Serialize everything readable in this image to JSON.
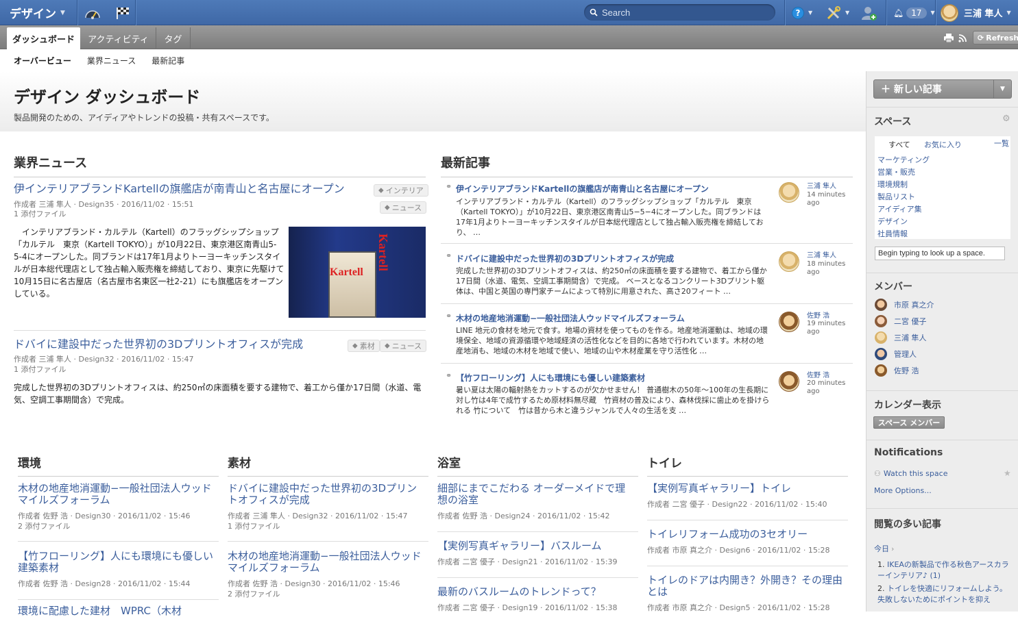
{
  "topbar": {
    "app_title": "デザイン",
    "search_placeholder": "Search",
    "notif_count": "17",
    "user_name": "三浦 隼人"
  },
  "tabs": [
    "ダッシュボード",
    "アクティビティ",
    "タグ"
  ],
  "refresh_label": "Refresh",
  "subnav": [
    "オーバービュー",
    "業界ニュース",
    "最新記事"
  ],
  "header": {
    "title": "デザイン ダッシュボード",
    "desc": "製品開発のための、アイディアやトレンドの投稿・共有スペースです。"
  },
  "industry_news": {
    "heading": "業界ニュース",
    "items": [
      {
        "title": "伊インテリアブランドKartellの旗艦店が南青山と名古屋にオープン",
        "meta": "作成者 三浦 隼人 · Design35 · 2016/11/02 · 15:51",
        "attach": "1 添付ファイル",
        "tags": [
          "インテリア",
          "ニュース"
        ],
        "body": [
          "　インテリアブランド・カルテル（Kartell）のフラッグシップショップ",
          "「カルテル　東京（Kartell TOKYO）」が10月22日、東京港区南青山5-",
          "5-4にオープンした。同ブランドは17年1月よりトーヨーキッチンスタイ",
          "ルが日本総代理店として独占輸入販売権を締結しており、東京に先駆けて",
          "10月15日に名古屋店（名古屋市名東区一社2-21）にも旗艦店をオープン",
          "している。"
        ],
        "image_text": "Kartell"
      },
      {
        "title": "ドバイに建設中だった世界初の3Dプリントオフィスが完成",
        "meta": "作成者 三浦 隼人 · Design32 · 2016/11/02 · 15:47",
        "attach": "1 添付ファイル",
        "tags": [
          "素材",
          "ニュース"
        ],
        "body": [
          "完成した世界初の3Dプリントオフィスは、約250㎡の床面積を要する建物で、着工から僅か17日間（水道、電",
          "気、空調工事期間含）で完成。"
        ]
      }
    ]
  },
  "recent": {
    "heading": "最新記事",
    "items": [
      {
        "title": "伊インテリアブランドKartellの旗艦店が南青山と名古屋にオープン",
        "body": [
          "インテリアブランド・カルテル（Kartell）のフラッグシップショップ「カルテル　東京",
          "（Kartell TOKYO）」が10月22日、東京港区南青山5−5−4にオープンした。同ブランドは",
          "17年1月よりトーヨーキッチンスタイルが日本総代理店として独占輸入販売権を締結してお",
          "り、 …"
        ],
        "user": "三浦 隼人",
        "time": "14 minutes ago"
      },
      {
        "title": "ドバイに建設中だった世界初の3Dプリントオフィスが完成",
        "body": [
          "完成した世界初の3Dプリントオフィスは、約250㎡の床面積を要する建物で、着工から僅か",
          "17日間（水道、電気、空調工事期間含）で完成。 ベースとなるコンクリート3Dプリント躯",
          "体は、中国と英国の専門家チームによって特別に用意された、高さ20フィート …"
        ],
        "user": "三浦 隼人",
        "time": "18 minutes ago"
      },
      {
        "title": "木材の地産地消運動−一般社団法人ウッドマイルズフォーラム",
        "body": [
          "LINE 地元の食材を地元で食す。地場の資材を使ってものを作る。地産地消運動は、地域の環",
          "境保全、地域の資源循環や地域経済の活性化などを目的に各地で行われています。木材の地",
          "産地消も、地域の木材を地域で使い、地域の山や木材産業を守り活性化 …"
        ],
        "user": "佐野 浩",
        "time": "19 minutes ago"
      },
      {
        "title": "【竹フローリング】人にも環境にも優しい建築素材",
        "body": [
          "暑い夏は太陽の輻射熱をカットするのが欠かせません！ 普通樹木の50年〜100年の生長期に",
          "対し竹は4年で成竹するため原材料無尽蔵　竹資材の普及により、森林伐採に歯止めを掛けら",
          "れる 竹について　竹は昔から木と違うジャンルで人々の生活を支 …"
        ],
        "user": "佐野 浩",
        "time": "20 minutes ago"
      }
    ]
  },
  "columns": [
    {
      "heading": "環境",
      "items": [
        {
          "title": [
            "木材の地産地消運動−一般社団法人ウッド",
            "マイルズフォーラム"
          ],
          "meta": "作成者 佐野 浩 · Design30 · 2016/11/02 · 15:46",
          "attach": "2 添付ファイル"
        },
        {
          "title": [
            "【竹フローリング】人にも環境にも優しい",
            "建築素材"
          ],
          "meta": "作成者 佐野 浩 · Design28 · 2016/11/02 · 15:44",
          "attach": ""
        },
        {
          "title": [
            "環境に配慮した建材　WPRC（木材"
          ],
          "meta": "",
          "attach": ""
        }
      ]
    },
    {
      "heading": "素材",
      "items": [
        {
          "title": [
            "ドバイに建設中だった世界初の3Dプリン",
            "トオフィスが完成"
          ],
          "meta": "作成者 三浦 隼人 · Design32 · 2016/11/02 · 15:47",
          "attach": "1 添付ファイル"
        },
        {
          "title": [
            "木材の地産地消運動−一般社団法人ウッド",
            "マイルズフォーラム"
          ],
          "meta": "作成者 佐野 浩 · Design30 · 2016/11/02 · 15:46",
          "attach": "2 添付ファイル"
        }
      ]
    },
    {
      "heading": "浴室",
      "items": [
        {
          "title": [
            "細部にまでこだわる オーダーメイドで理",
            "想の浴室"
          ],
          "meta": "作成者 佐野 浩 · Design24 · 2016/11/02 · 15:42",
          "attach": ""
        },
        {
          "title": [
            "【実例写真ギャラリー】バスルーム"
          ],
          "meta": "作成者 二宮 優子 · Design21 · 2016/11/02 · 15:39",
          "attach": ""
        },
        {
          "title": [
            "最新のバスルームのトレンドって？"
          ],
          "meta": "作成者 二宮 優子 · Design19 · 2016/11/02 · 15:38",
          "attach": ""
        }
      ]
    },
    {
      "heading": "トイレ",
      "items": [
        {
          "title": [
            "【実例写真ギャラリー】トイレ"
          ],
          "meta": "作成者 二宮 優子 · Design22 · 2016/11/02 · 15:40",
          "attach": ""
        },
        {
          "title": [
            "トイレリフォーム成功の3セオリー"
          ],
          "meta": "作成者 市原 真之介 · Design6 · 2016/11/02 · 15:28",
          "attach": ""
        },
        {
          "title": [
            "トイレのドアは内開き？外開き？その理由",
            "とは"
          ],
          "meta": "作成者 市原 真之介 · Design5 · 2016/11/02 · 15:28",
          "attach": ""
        }
      ]
    }
  ],
  "sidebar": {
    "new_article": "新しい記事",
    "spaces_heading": "スペース",
    "space_tabs": [
      "すべて",
      "お気に入り"
    ],
    "list_link": "一覧",
    "spaces": [
      "マーケティング",
      "営業・販売",
      "環境規制",
      "製品リスト",
      "アイディア集",
      "デザイン",
      "社員情報"
    ],
    "space_search": "Begin typing to look up a space.",
    "members_heading": "メンバー",
    "members": [
      "市原 真之介",
      "二宮 優子",
      "三浦 隼人",
      "管理人",
      "佐野 浩"
    ],
    "calendar_heading": "カレンダー表示",
    "calendar_btn": "スペース メンバー",
    "notifications_heading": "Notifications",
    "watch": "Watch this space",
    "more_options": "More Options...",
    "popular_heading": "閲覧の多い記事",
    "today": "今日",
    "popular": [
      "IKEAの新製品で作る秋色アースカラーインテリア♪ (1)",
      "トイレを快適にリフォームしよう。失敗しないためにポイントを抑え"
    ]
  },
  "colors": {
    "topbar": "#4a74b2",
    "link": "#3b5e9c",
    "sidebar": "#ededed"
  }
}
